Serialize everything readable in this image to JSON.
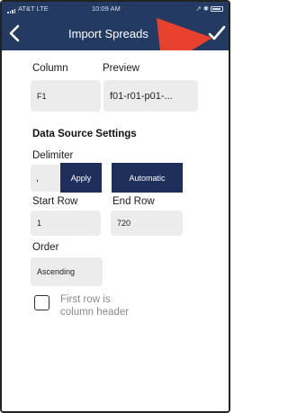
{
  "status_bar": {
    "carrier": "AT&T LTE",
    "time": "10:09 AM",
    "right_text": "↗ ✱"
  },
  "nav": {
    "title": "Import Spreads"
  },
  "columns": {
    "column_label": "Column",
    "preview_label": "Preview",
    "column_value": "F1",
    "preview_value": "f01-r01-p01-..."
  },
  "data_source": {
    "title": "Data Source Settings",
    "delimiter_label": "Delimiter",
    "delimiter_value": ",",
    "apply_label": "Apply",
    "automatic_label": "Automatic",
    "start_row_label": "Start Row",
    "start_row_value": "1",
    "end_row_label": "End Row",
    "end_row_value": "720",
    "order_label": "Order",
    "order_value": "Ascending",
    "header_checkbox_line1": "First row is",
    "header_checkbox_line2": "column header",
    "header_checkbox_checked": false
  },
  "colors": {
    "nav_background": "#233a63",
    "button_background": "#1f2f5b",
    "field_background": "#ececec",
    "annotation_arrow": "#e8412e"
  },
  "icons": {
    "back": "chevron-left-icon",
    "confirm": "checkmark-icon",
    "annotation": "red-arrow-pointer"
  }
}
